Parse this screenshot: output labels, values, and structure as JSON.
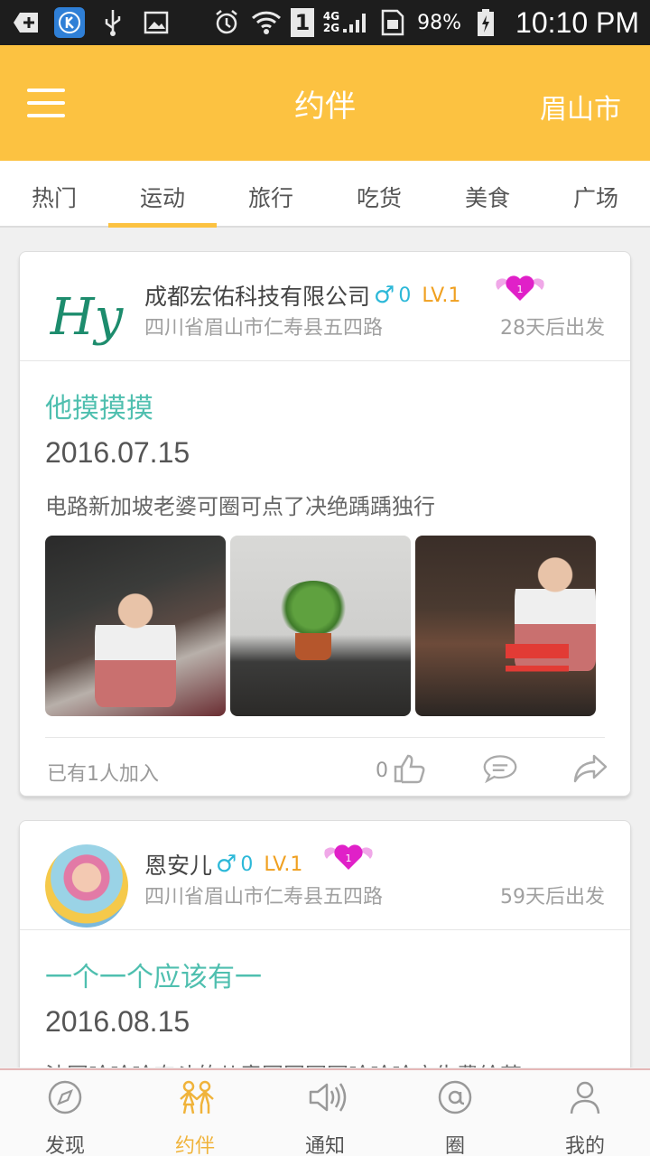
{
  "status_bar": {
    "network_top": "4G",
    "network_bottom": "2G",
    "sim_slot": "1",
    "battery_percent": "98%",
    "time": "10:10 PM"
  },
  "header": {
    "title": "约伴",
    "city": "眉山市"
  },
  "tabs": [
    {
      "label": "热门",
      "active": false
    },
    {
      "label": "运动",
      "active": true
    },
    {
      "label": "旅行",
      "active": false
    },
    {
      "label": "吃货",
      "active": false
    },
    {
      "label": "美食",
      "active": false
    },
    {
      "label": "广场",
      "active": false
    }
  ],
  "posts": [
    {
      "avatar_text": "Hy",
      "user_name": "成都宏佑科技有限公司",
      "gender_symbol": "♂",
      "follower_count": "0",
      "level": "LV.1",
      "badge_number": "1",
      "location": "四川省眉山市仁寿县五四路",
      "depart": "28天后出发",
      "title": "他摸摸摸",
      "date": "2016.07.15",
      "text": "电路新加坡老婆可圈可点了决绝踽踽独行",
      "joined": "已有1人加入",
      "likes": "0"
    },
    {
      "user_name": "恩安儿",
      "gender_symbol": "♂",
      "follower_count": "0",
      "level": "LV.1",
      "badge_number": "1",
      "location": "四川省眉山市仁寿县五四路",
      "depart": "59天后出发",
      "title": "一个一个应该有一",
      "date": "2016.08.15",
      "text": "法国哈哈哈奋斗的儿童团团圆圆哈哈哈广告费给茉"
    }
  ],
  "bottom_nav": [
    {
      "label": "发现",
      "icon": "compass-icon"
    },
    {
      "label": "约伴",
      "icon": "companions-icon",
      "active": true
    },
    {
      "label": "通知",
      "icon": "speaker-icon"
    },
    {
      "label": "圈",
      "icon": "at-icon"
    },
    {
      "label": "我的",
      "icon": "person-icon"
    }
  ],
  "colors": {
    "accent": "#fcc241",
    "title_teal": "#4fbfaf",
    "gender_blue": "#2cb8d8",
    "level_orange": "#f0a020",
    "badge_pink": "#e020c8"
  }
}
